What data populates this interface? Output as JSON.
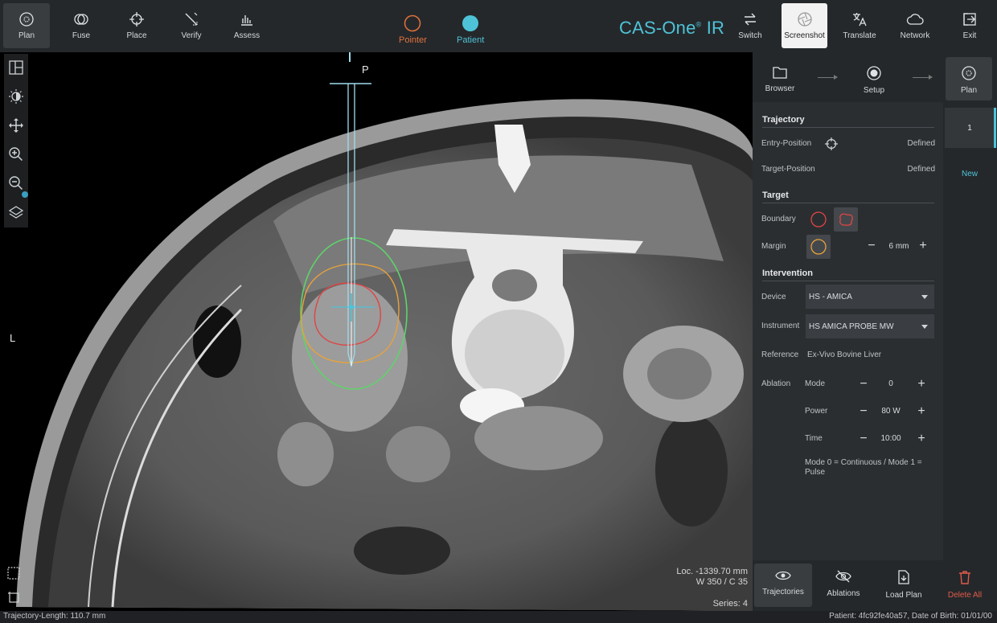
{
  "toolbar": {
    "items": [
      {
        "label": "Plan",
        "icon": "plan-icon"
      },
      {
        "label": "Fuse",
        "icon": "fuse-icon"
      },
      {
        "label": "Place",
        "icon": "crosshair-icon"
      },
      {
        "label": "Verify",
        "icon": "verify-icon"
      },
      {
        "label": "Assess",
        "icon": "chart-icon"
      }
    ],
    "modes": [
      {
        "label": "Pointer",
        "color": "#e0723c"
      },
      {
        "label": "Patient",
        "color": "#4ec3d8"
      }
    ],
    "brand": "CAS-One",
    "brand_mark": "®",
    "brand_suffix": " IR",
    "right_items": [
      {
        "label": "Switch",
        "icon": "swap-icon"
      },
      {
        "label": "Screenshot",
        "icon": "aperture-icon"
      },
      {
        "label": "Translate",
        "icon": "translate-icon"
      },
      {
        "label": "Network",
        "icon": "cloud-icon"
      },
      {
        "label": "Exit",
        "icon": "exit-icon"
      }
    ]
  },
  "viewer": {
    "orientation_top": "P",
    "orientation_left": "L",
    "loc": "Loc. -1339.70 mm",
    "window": "W 350 / C 35",
    "series": "Series: 4"
  },
  "workflow": {
    "steps": [
      {
        "label": "Browser",
        "icon": "folder-icon"
      },
      {
        "label": "Setup",
        "icon": "target-icon"
      },
      {
        "label": "Plan",
        "icon": "plan-icon"
      }
    ]
  },
  "tabs": [
    "1",
    "New"
  ],
  "panel": {
    "trajectory": {
      "title": "Trajectory",
      "entry_label": "Entry-Position",
      "entry_value": "Defined",
      "target_label": "Target-Position",
      "target_value": "Defined"
    },
    "target": {
      "title": "Target",
      "boundary_label": "Boundary",
      "margin_label": "Margin",
      "margin_value": "6 mm"
    },
    "intervention": {
      "title": "Intervention",
      "device_label": "Device",
      "device_value": "HS - AMICA",
      "instrument_label": "Instrument",
      "instrument_value": "HS AMICA PROBE MW",
      "reference_label": "Reference",
      "reference_value": "Ex-Vivo Bovine Liver",
      "ablation_label": "Ablation",
      "mode_label": "Mode",
      "mode_value": "0",
      "power_label": "Power",
      "power_value": "80 W",
      "time_label": "Time",
      "time_value": "10:00",
      "note": "Mode 0 = Continuous / Mode 1 = Pulse"
    }
  },
  "bottom": {
    "items": [
      {
        "label": "Trajectories",
        "icon": "eye-icon"
      },
      {
        "label": "Ablations",
        "icon": "eye-off-icon"
      },
      {
        "label": "Load Plan",
        "icon": "load-file-icon"
      },
      {
        "label": "Delete All",
        "icon": "trash-icon"
      }
    ]
  },
  "status": {
    "left": "Trajectory-Length: 110.7 mm",
    "right": "Patient: 4fc92fe40a57, Date of Birth: 01/01/00"
  },
  "colors": {
    "accent": "#4ec3d8",
    "pointer": "#e0723c",
    "delete": "#e05a4a",
    "contour_green": "#5fd36a",
    "contour_orange": "#e7a23c",
    "contour_red": "#e04444"
  }
}
